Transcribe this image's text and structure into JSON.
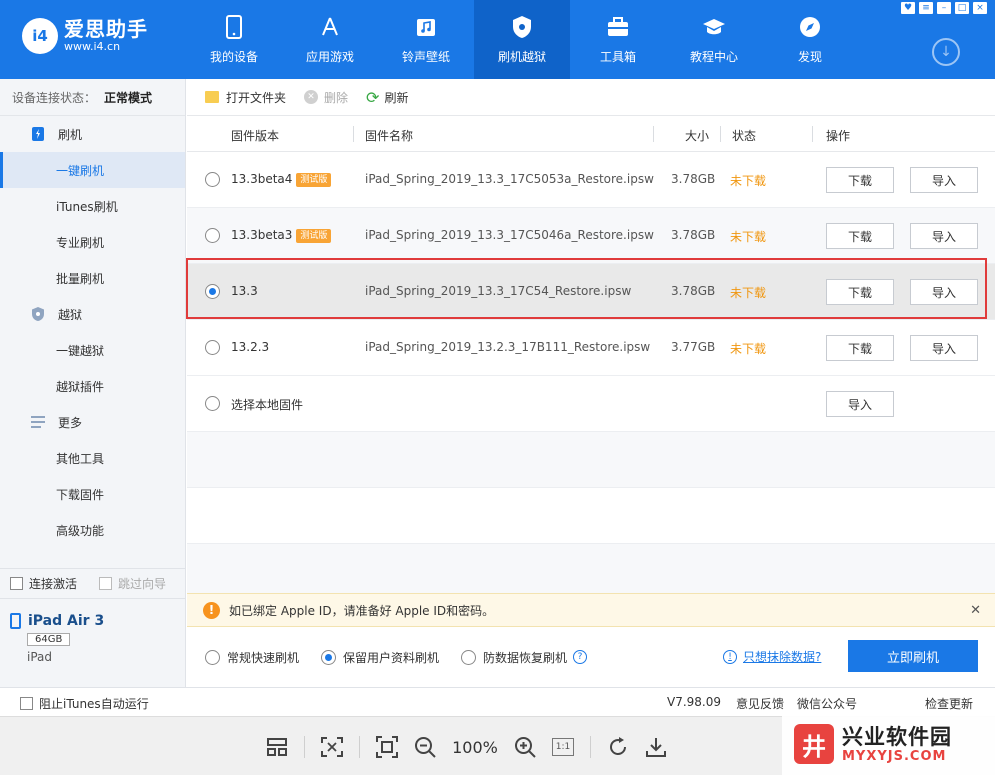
{
  "app": {
    "logo_badge": "i4",
    "logo_name": "爱思助手",
    "logo_url": "www.i4.cn"
  },
  "nav": [
    {
      "label": "我的设备",
      "icon": "phone-icon"
    },
    {
      "label": "应用游戏",
      "icon": "app-store-icon"
    },
    {
      "label": "铃声壁纸",
      "icon": "music-icon"
    },
    {
      "label": "刷机越狱",
      "icon": "flash-jailbreak-icon"
    },
    {
      "label": "工具箱",
      "icon": "toolbox-icon"
    },
    {
      "label": "教程中心",
      "icon": "graduation-cap-icon"
    },
    {
      "label": "发现",
      "icon": "compass-icon"
    }
  ],
  "sidebar": {
    "status_label": "设备连接状态：",
    "status_value": "正常模式",
    "groups": [
      {
        "label": "刷机",
        "items": [
          "一键刷机",
          "iTunes刷机",
          "专业刷机",
          "批量刷机"
        ]
      },
      {
        "label": "越狱",
        "items": [
          "一键越狱",
          "越狱插件"
        ]
      },
      {
        "label": "更多",
        "items": [
          "其他工具",
          "下载固件",
          "高级功能"
        ]
      }
    ],
    "auto_activate": "连接激活",
    "skip_guide": "跳过向导",
    "device_name": "iPad Air 3",
    "device_capacity": "64GB",
    "device_type": "iPad"
  },
  "toolbar": {
    "open_folder": "打开文件夹",
    "delete": "删除",
    "refresh": "刷新"
  },
  "table": {
    "headers": [
      "固件版本",
      "固件名称",
      "大小",
      "状态",
      "操作"
    ],
    "rows": [
      {
        "version": "13.3beta4",
        "badge": "测试版",
        "file": "iPad_Spring_2019_13.3_17C5053a_Restore.ipsw",
        "size": "3.78GB",
        "status": "未下载",
        "download": "下载",
        "import": "导入"
      },
      {
        "version": "13.3beta3",
        "badge": "测试版",
        "file": "iPad_Spring_2019_13.3_17C5046a_Restore.ipsw",
        "size": "3.78GB",
        "status": "未下载",
        "download": "下载",
        "import": "导入"
      },
      {
        "version": "13.3",
        "badge": "",
        "file": "iPad_Spring_2019_13.3_17C54_Restore.ipsw",
        "size": "3.78GB",
        "status": "未下载",
        "download": "下载",
        "import": "导入"
      },
      {
        "version": "13.2.3",
        "badge": "",
        "file": "iPad_Spring_2019_13.2.3_17B111_Restore.ipsw",
        "size": "3.77GB",
        "status": "未下载",
        "download": "下载",
        "import": "导入"
      }
    ],
    "local": {
      "label": "选择本地固件",
      "import": "导入"
    }
  },
  "alert": {
    "text": "如已绑定 Apple ID，请准备好 Apple ID和密码。"
  },
  "options": {
    "modes": [
      "常规快速刷机",
      "保留用户资料刷机",
      "防数据恢复刷机"
    ],
    "selected": "保留用户资料刷机",
    "erase_link": "只想抹除数据?",
    "flash_button": "立即刷机"
  },
  "statusbar": {
    "block_itunes": "阻止iTunes自动运行",
    "version": "V7.98.09",
    "feedback": "意见反馈",
    "wechat": "微信公众号",
    "update": "检查更新"
  },
  "viewer": {
    "zoom": "100%"
  },
  "watermark": {
    "badge": "井",
    "title": "兴业软件园",
    "url": "MYXYJS.COM"
  },
  "colors": {
    "brand_blue": "#1a78e6",
    "status_orange": "#f0960f",
    "highlight_red": "#e03b3b"
  }
}
